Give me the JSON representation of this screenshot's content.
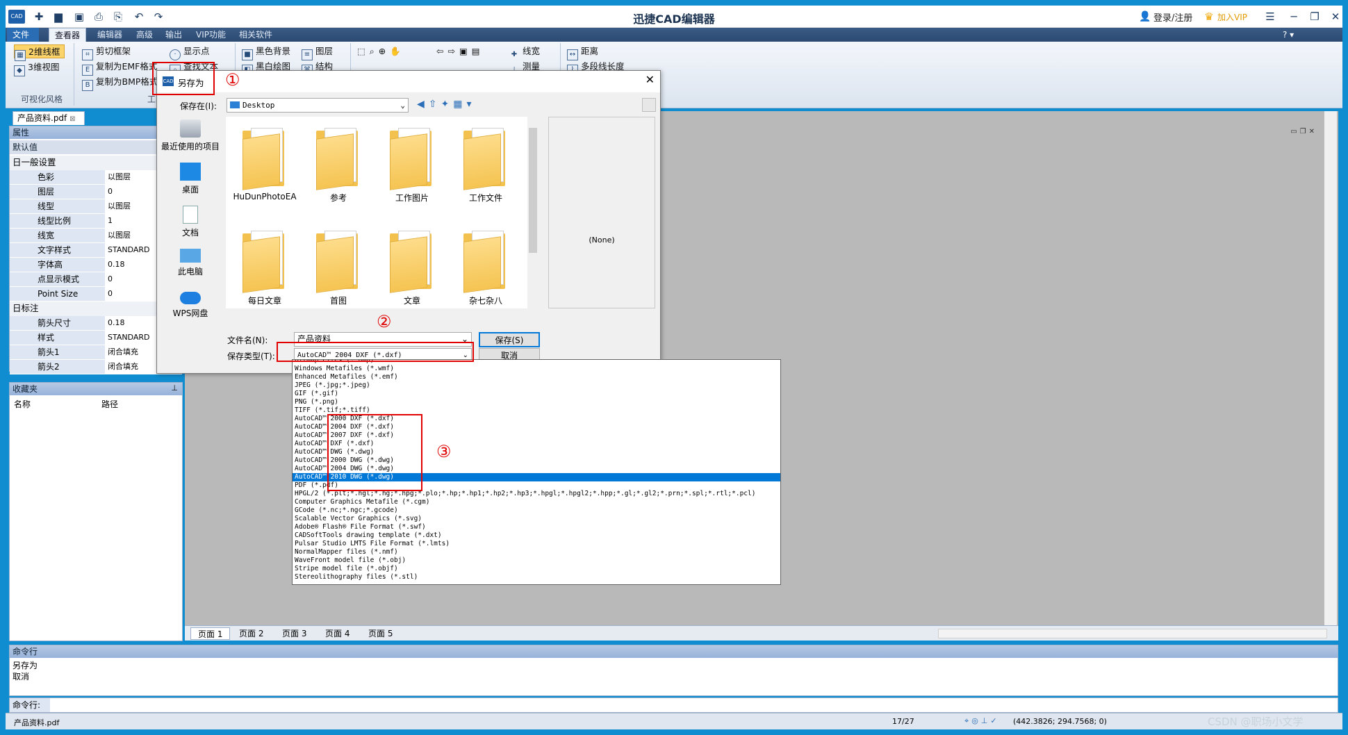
{
  "app": {
    "title": "迅捷CAD编辑器",
    "login": "登录/注册",
    "vip": "加入VIP",
    "cad_logo": "CAD",
    "menu": [
      "文件",
      "查看器",
      "编辑器",
      "高级",
      "输出",
      "VIP功能",
      "相关软件"
    ]
  },
  "ribbon": {
    "view2d": "2维线框",
    "view3d": "3维视图",
    "visual_style": "可视化风格",
    "clip_frame": "剪切框架",
    "copy_emf": "复制为EMF格式",
    "copy_bmp": "复制为BMP格式",
    "tools": "工具",
    "show_points": "显示点",
    "find_text": "查找文本",
    "black_bg": "黑色背景",
    "white_draw": "黑白绘图",
    "layers": "图层",
    "structure": "结构",
    "line_width": "线宽",
    "measure": "测量",
    "distance": "距离",
    "polyline_length": "多段线长度"
  },
  "doc_tab": "产品资料.pdf",
  "properties": {
    "header": "属性",
    "default": "默认值",
    "general": "日一般设置",
    "rows": [
      {
        "k": "色彩",
        "v": "以图层"
      },
      {
        "k": "图层",
        "v": "0"
      },
      {
        "k": "线型",
        "v": "以图层"
      },
      {
        "k": "线型比例",
        "v": "1"
      },
      {
        "k": "线宽",
        "v": "以图层"
      },
      {
        "k": "文字样式",
        "v": "STANDARD"
      },
      {
        "k": "字体高",
        "v": "0.18"
      },
      {
        "k": "点显示模式",
        "v": "0"
      },
      {
        "k": "Point Size",
        "v": "0"
      }
    ],
    "annot": "日标注",
    "annot_rows": [
      {
        "k": "箭头尺寸",
        "v": "0.18"
      },
      {
        "k": "样式",
        "v": "STANDARD"
      },
      {
        "k": "箭头1",
        "v": "闭合填充"
      },
      {
        "k": "箭头2",
        "v": "闭合填充"
      }
    ]
  },
  "favorites": {
    "header": "收藏夹",
    "col_name": "名称",
    "col_path": "路径"
  },
  "pages": [
    "页面 1",
    "页面 2",
    "页面 3",
    "页面 4",
    "页面 5"
  ],
  "command": {
    "header": "命令行",
    "lines": [
      "另存为",
      "取消"
    ],
    "label": "命令行:"
  },
  "status": {
    "file": "产品资料.pdf",
    "page": "17/27",
    "coords": "(442.3826; 294.7568; 0)",
    "watermark": "CSDN @职场小文学"
  },
  "dialog": {
    "title": "另存为",
    "save_in_label": "保存在(I):",
    "save_in_value": "Desktop",
    "places": [
      "最近使用的项目",
      "桌面",
      "文档",
      "此电脑",
      "WPS网盘"
    ],
    "folders": [
      "HuDunPhotoEA",
      "参考",
      "工作图片",
      "工作文件",
      "每日文章",
      "首图",
      "文章",
      "杂七杂八"
    ],
    "preview": "(None)",
    "filename_label": "文件名(N):",
    "filename_value": "产品资料",
    "type_label": "保存类型(T):",
    "type_value": "AutoCAD™ 2004 DXF (*.dxf)",
    "save": "保存(S)",
    "cancel": "取消"
  },
  "file_types": [
    "Bitmap Files (*.bmp)",
    "Windows Metafiles (*.wmf)",
    "Enhanced Metafiles (*.emf)",
    "JPEG (*.jpg;*.jpeg)",
    "GIF (*.gif)",
    "PNG (*.png)",
    "TIFF (*.tif;*.tiff)",
    "AutoCAD™ 2000 DXF (*.dxf)",
    "AutoCAD™ 2004 DXF (*.dxf)",
    "AutoCAD™ 2007 DXF (*.dxf)",
    "AutoCAD™ DXF (*.dxf)",
    "AutoCAD™ DWG (*.dwg)",
    "AutoCAD™ 2000 DWG (*.dwg)",
    "AutoCAD™ 2004 DWG (*.dwg)",
    "AutoCAD™ 2010 DWG (*.dwg)",
    "PDF (*.pdf)",
    "HPGL/2 (*.plt;*.hgl;*.hg;*.hpg;*.plo;*.hp;*.hp1;*.hp2;*.hp3;*.hpgl;*.hpgl2;*.hpp;*.gl;*.gl2;*.prn;*.spl;*.rtl;*.pcl)",
    "Computer Graphics Metafile (*.cgm)",
    "GCode (*.nc;*.ngc;*.gcode)",
    "Scalable Vector Graphics (*.svg)",
    "Adobe® Flash® File Format (*.swf)",
    "CADSoftTools drawing template (*.dxt)",
    "Pulsar Studio LMTS File Format (*.lmts)",
    "NormalMapper files (*.nmf)",
    "WaveFront model file (*.obj)",
    "Stripe model file (*.objf)",
    "Stereolithography files (*.stl)"
  ],
  "selected_type_index": 14,
  "annotations": [
    "①",
    "②",
    "③"
  ],
  "colors": {
    "accent": "#0078d7",
    "annotation": "#e00000",
    "frame": "#0f8dd0"
  }
}
